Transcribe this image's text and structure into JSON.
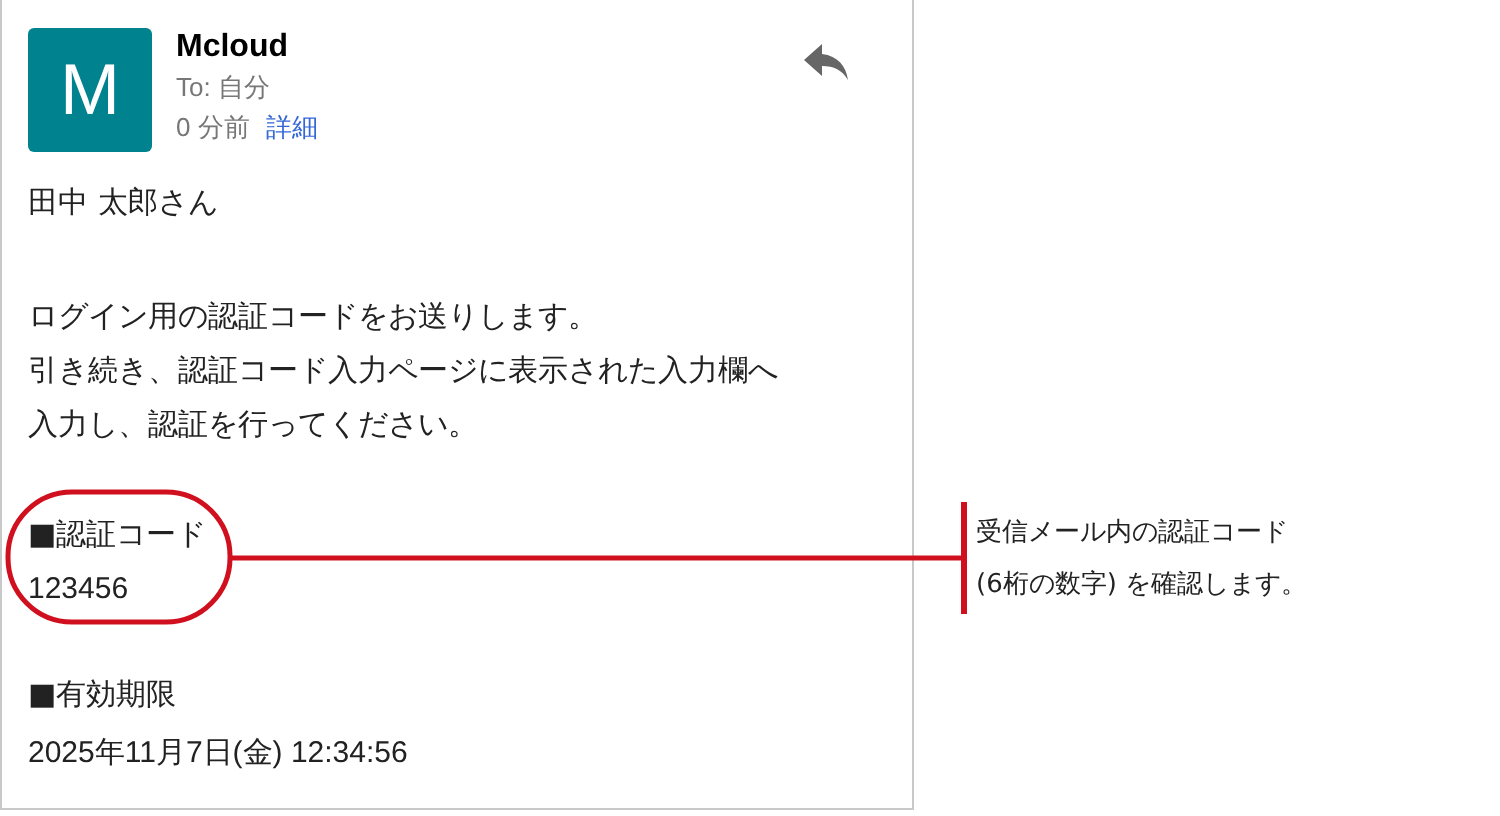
{
  "email": {
    "avatar": "M",
    "sender": "Mcloud",
    "to": "To: 自分",
    "time": "0 分前",
    "details_link": "詳細",
    "greeting": "田中 太郎さん",
    "message_lines": [
      "ログイン用の認証コードをお送りします。",
      "引き続き、認証コード入力ページに表示された入力欄へ",
      "入力し、認証を行ってください。"
    ],
    "code_label": "■認証コード",
    "code": "123456",
    "expiry_label": "■有効期限",
    "expiry": "2025年11月7日(金) 12:34:56"
  },
  "annotation": {
    "lines": [
      "受信メール内の認証コード",
      "(6桁の数字) を確認します。"
    ]
  }
}
